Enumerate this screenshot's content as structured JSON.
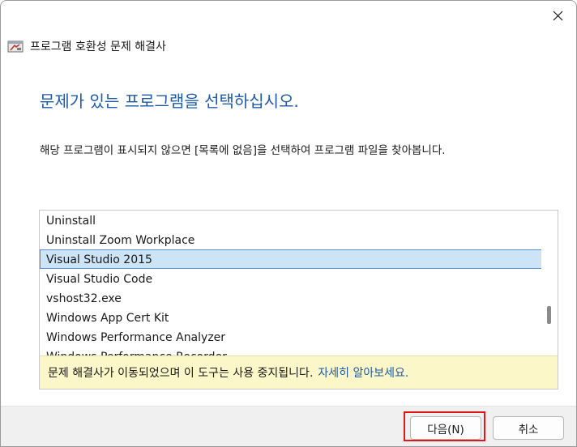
{
  "window": {
    "title": "프로그램 호환성 문제 해결사",
    "icons": {
      "app": "troubleshooter-window-icon",
      "close": "close-icon"
    }
  },
  "main": {
    "heading": "문제가 있는 프로그램을 선택하십시오.",
    "instruction": "해당 프로그램이 표시되지 않으면 [목록에 없음]을 선택하여 프로그램 파일을 찾아봅니다."
  },
  "program_list": {
    "items": [
      "Uninstall",
      "Uninstall Zoom Workplace",
      "Visual Studio 2015",
      "Visual Studio Code",
      "vshost32.exe",
      "Windows App Cert Kit",
      "Windows Performance Analyzer",
      "Windows Performance Recorder"
    ],
    "selected_index": 2,
    "scroll_position": 0.85
  },
  "notice": {
    "text": "문제 해결사가 이동되었으며 이 도구는 사용 중지됩니다.",
    "link": "자세히 알아보세요."
  },
  "footer": {
    "next_label": "다음(N)",
    "cancel_label": "취소"
  },
  "colors": {
    "heading": "#1d5aa8",
    "selected_bg": "#cde4f7",
    "notice_bg": "#fbf7c8",
    "highlight_border": "#e01818"
  }
}
